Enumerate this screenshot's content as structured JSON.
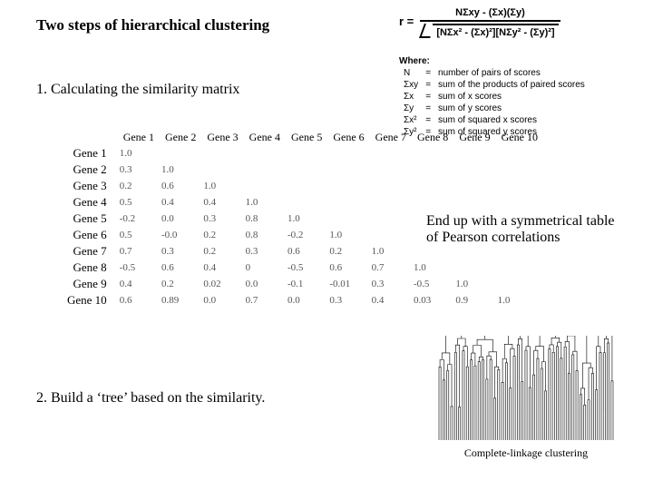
{
  "title": "Two steps of hierarchical clustering",
  "step1": "1.  Calculating the similarity matrix",
  "step2": "2.  Build a ‘tree’ based on the similarity.",
  "result_text": "End up with a symmetrical table of Pearson correlations",
  "formula": {
    "r_label": "r =",
    "numerator": "NΣxy - (Σx)(Σy)",
    "den_inner": "[NΣx² - (Σx)²][NΣy² - (Σy)²]"
  },
  "where_label": "Where:",
  "where": [
    {
      "sym": "N",
      "desc": "number of pairs of scores"
    },
    {
      "sym": "Σxy",
      "desc": "sum of the products of paired scores"
    },
    {
      "sym": "Σx",
      "desc": "sum of x scores"
    },
    {
      "sym": "Σy",
      "desc": "sum of y scores"
    },
    {
      "sym": "Σx²",
      "desc": "sum of squared x scores"
    },
    {
      "sym": "Σy²",
      "desc": "sum of squared y scores"
    }
  ],
  "matrix": {
    "row_labels": [
      "Gene 1",
      "Gene 2",
      "Gene 3",
      "Gene 4",
      "Gene 5",
      "Gene 6",
      "Gene 7",
      "Gene 8",
      "Gene 9",
      "Gene 10"
    ],
    "col_labels": [
      "Gene 1",
      "Gene 2",
      "Gene 3",
      "Gene 4",
      "Gene 5",
      "Gene 6",
      "Gene 7",
      "Gene 8",
      "Gene 9",
      "Gene 10"
    ],
    "cells": [
      [
        "1.0"
      ],
      [
        "0.3",
        "1.0"
      ],
      [
        "0.2",
        "0.6",
        "1.0"
      ],
      [
        "0.5",
        "0.4",
        "0.4",
        "1.0"
      ],
      [
        "-0.2",
        "0.0",
        "0.3",
        "0.8",
        "1.0"
      ],
      [
        "0.5",
        "-0.0",
        "0.2",
        "0.8",
        "-0.2",
        "1.0"
      ],
      [
        "0.7",
        "0.3",
        "0.2",
        "0.3",
        "0.6",
        "0.2",
        "1.0"
      ],
      [
        "-0.5",
        "0.6",
        "0.4",
        "0",
        "-0.5",
        "0.6",
        "0.7",
        "1.0"
      ],
      [
        "0.4",
        "0.2",
        "0.02",
        "0.0",
        "-0.1",
        "-0.01",
        "0.3",
        "-0.5",
        "1.0"
      ],
      [
        "0.6",
        "0.89",
        "0.0",
        "0.7",
        "0.0",
        "0.3",
        "0.4",
        "0.03",
        "0.9",
        "1.0"
      ]
    ]
  },
  "dendro_caption": "Complete-linkage clustering"
}
